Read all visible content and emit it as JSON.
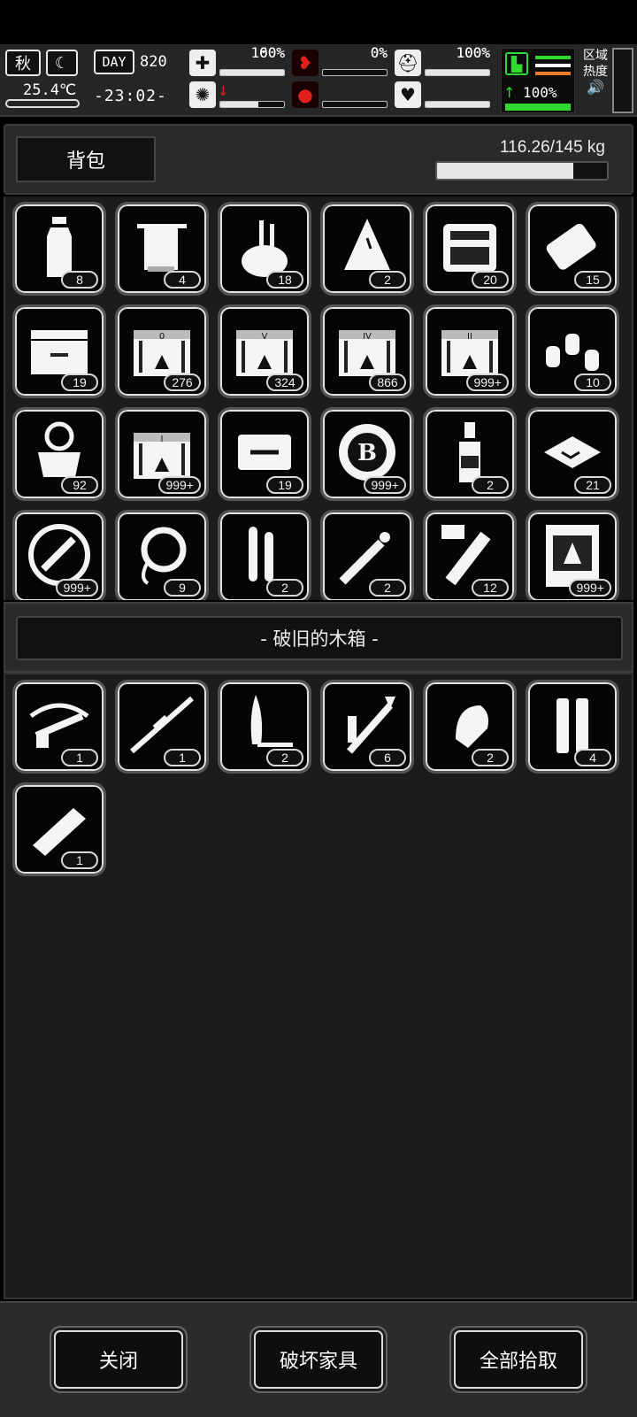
{
  "hud": {
    "season": "秋",
    "temperature": "25.4℃",
    "day_label": "DAY",
    "day_number": "820",
    "clock": "-23:02-",
    "stats": [
      {
        "icon": "medkit-icon",
        "value": "100%",
        "fill": 1.0
      },
      {
        "icon": "stomach-icon",
        "value": "0%",
        "fill": 0.0
      },
      {
        "icon": "helmet-icon",
        "value": "100%",
        "fill": 1.0
      },
      {
        "icon": "brain-icon",
        "value": "60%",
        "fill": 0.6,
        "trend": "↓"
      },
      {
        "icon": "blood-drop-icon",
        "value": "0%",
        "fill": 0.0
      },
      {
        "icon": "heart-icon",
        "value": "100%",
        "fill": 1.0
      }
    ],
    "stamina": {
      "value": "100%",
      "trend": "↑",
      "fill": 1.0
    },
    "zone_heat_line1": "区域",
    "zone_heat_line2": "热度",
    "colors": {
      "danger": "#e0201c",
      "stamina": "#2fd92f",
      "heat": "#ef7a2a"
    }
  },
  "backpack": {
    "title": "背包",
    "weight": "116.26/145 kg",
    "weight_fill": 0.8,
    "items": [
      {
        "name": "water-bottle-icon",
        "count": "8"
      },
      {
        "name": "towel-icon",
        "count": "4"
      },
      {
        "name": "tool-bag-icon",
        "count": "18"
      },
      {
        "name": "cloth-rag-icon",
        "count": "2"
      },
      {
        "name": "repair-kit-icon",
        "count": "20"
      },
      {
        "name": "paper-scroll-icon",
        "count": "15"
      },
      {
        "name": "toolbox-icon",
        "count": "19"
      },
      {
        "name": "crate-0-icon",
        "count": "276"
      },
      {
        "name": "crate-v-icon",
        "count": "324"
      },
      {
        "name": "crate-iv-icon",
        "count": "866"
      },
      {
        "name": "crate-ii-icon",
        "count": "999+"
      },
      {
        "name": "spray-cans-icon",
        "count": "10"
      },
      {
        "name": "tool-bucket-icon",
        "count": "92"
      },
      {
        "name": "crate-i-icon",
        "count": "999+"
      },
      {
        "name": "pliers-case-icon",
        "count": "19"
      },
      {
        "name": "bitcoin-chip-icon",
        "count": "999+"
      },
      {
        "name": "liquor-bottle-icon",
        "count": "2"
      },
      {
        "name": "scrap-plates-icon",
        "count": "21"
      },
      {
        "name": "tool-badge-icon",
        "count": "999+"
      },
      {
        "name": "rope-coil-icon",
        "count": "9"
      },
      {
        "name": "test-tubes-icon",
        "count": "2"
      },
      {
        "name": "syringe-icon",
        "count": "2"
      },
      {
        "name": "vii-vial-icon",
        "count": "12"
      },
      {
        "name": "zombie-card-icon",
        "count": "999+"
      }
    ]
  },
  "container": {
    "name": "- 破旧的木箱 -",
    "items": [
      {
        "name": "crossbow-icon",
        "count": "1"
      },
      {
        "name": "sniper-rifle-icon",
        "count": "1"
      },
      {
        "name": "knife-icon",
        "count": "2"
      },
      {
        "name": "rpg-launcher-icon",
        "count": "6"
      },
      {
        "name": "bullet-tip-icon",
        "count": "2"
      },
      {
        "name": "shell-casings-icon",
        "count": "4"
      },
      {
        "name": "bar-icon",
        "count": "1"
      }
    ]
  },
  "actions": {
    "close": "关闭",
    "destroy": "破坏家具",
    "take_all": "全部拾取"
  }
}
